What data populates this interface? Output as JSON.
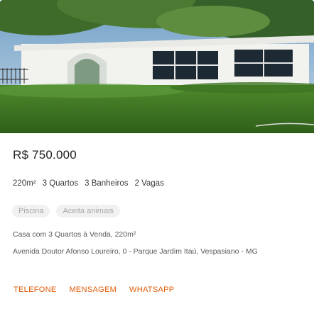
{
  "listing": {
    "photo_alt_icon": "property-photo",
    "price": "R$ 750.000",
    "features": [
      "220m²",
      "3 Quartos",
      "3 Banheiros",
      "2 Vagas"
    ],
    "amenities": [
      "Piscina",
      "Aceita animais"
    ],
    "title": "Casa com 3 Quartos à Venda, 220m²",
    "address": "Avenida Doutor Afonso Loureiro, 0 - Parque Jardim Itaú, Vespasiano - MG"
  },
  "actions": {
    "phone": "TELEFONE",
    "message": "MENSAGEM",
    "whatsapp": "WHATSAPP"
  },
  "colors": {
    "accent": "#e15a06",
    "tag_bg": "#f1f1f1",
    "tag_text": "#a8a8a8"
  }
}
